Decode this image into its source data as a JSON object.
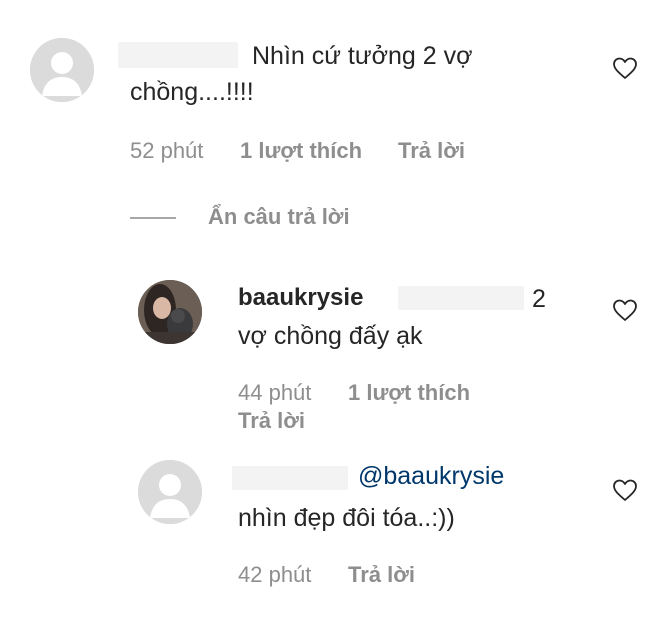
{
  "comment1": {
    "text_line1": "Nhìn cứ tưởng 2 vợ",
    "text_line2": "chồng....!!!!",
    "time": "52 phút",
    "likes": "1 lượt thích",
    "reply": "Trả lời",
    "heart_icon": "heart-outline-icon"
  },
  "hide_replies": {
    "label": "Ẩn câu trả lời"
  },
  "reply1": {
    "username": "baaukrysie",
    "mention_count": "2",
    "text": "vợ chồng đấy ạk",
    "time": "44 phút",
    "likes": "1 lượt thích",
    "reply": "Trả lời"
  },
  "reply2": {
    "mention": "@baaukrysie",
    "text": "nhìn đẹp đôi tóa..:))",
    "time": "42 phút",
    "reply": "Trả lời"
  },
  "colors": {
    "text": "#262626",
    "meta": "#8e8e8e",
    "mention": "#00376b",
    "avatar_bg": "#dbdbdb"
  }
}
